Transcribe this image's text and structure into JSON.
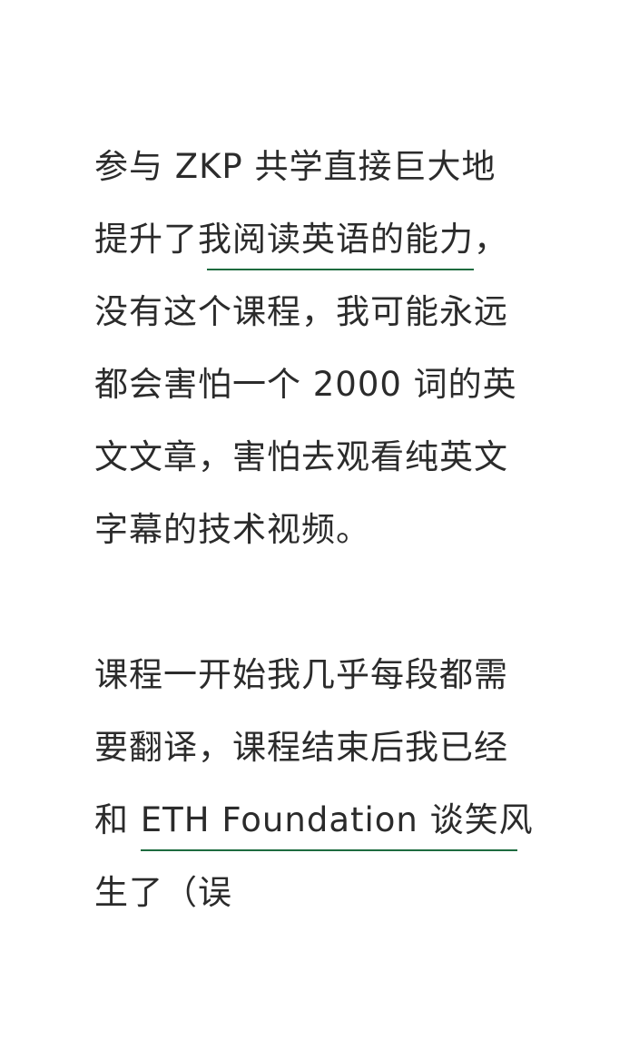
{
  "paragraph1": {
    "line1": "参与 ZKP 共学直接巨大地",
    "line2_pre": "提升了",
    "line2_highlight": "我阅读英语的能力",
    "line2_post": "，",
    "line3": "没有这个课程，我可能永远",
    "line4": "都会害怕一个 2000 词的英",
    "line5": "文文章，害怕去观看纯英文",
    "line6": "字幕的技术视频。"
  },
  "paragraph2": {
    "line1": "课程一开始我几乎每段都需",
    "line2": "要翻译，课程结束后我已经",
    "line3_pre": "和 ",
    "line3_highlight": "ETH Foundation 谈笑风",
    "line4": "生了（误"
  },
  "colors": {
    "text": "#2b2b2b",
    "underline": "#1d6b3f",
    "background": "#ffffff"
  }
}
